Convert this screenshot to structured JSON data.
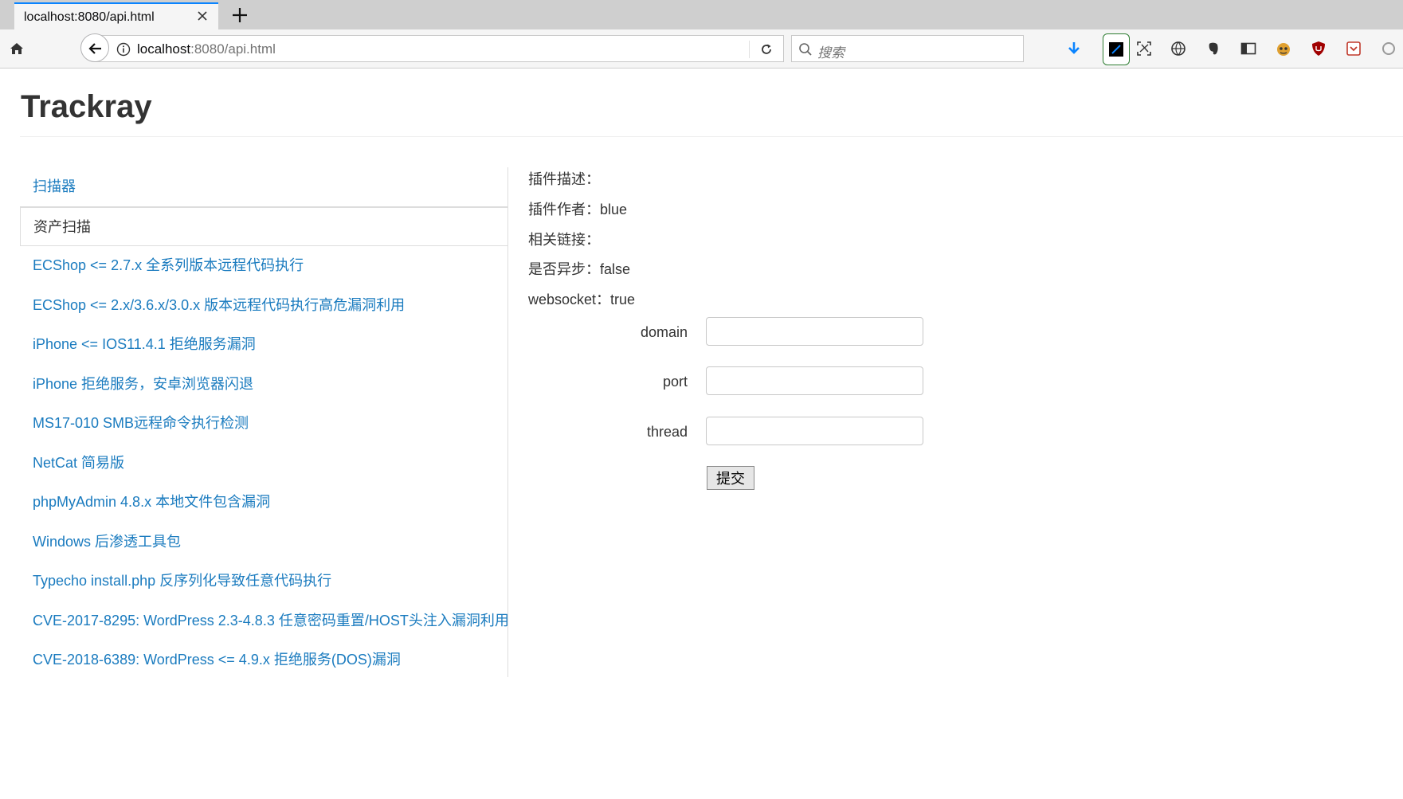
{
  "browser": {
    "tab_title": "localhost:8080/api.html",
    "url_host": "localhost",
    "url_rest": ":8080/api.html",
    "search_placeholder": "搜索",
    "accent_color": "#0a84ff"
  },
  "page": {
    "title": "Trackray"
  },
  "sidebar": {
    "items": [
      {
        "label": "扫描器",
        "type": "link"
      },
      {
        "label": "资产扫描",
        "type": "category"
      },
      {
        "label": "ECShop <= 2.7.x 全系列版本远程代码执行",
        "type": "link"
      },
      {
        "label": "ECShop <= 2.x/3.6.x/3.0.x 版本远程代码执行高危漏洞利用",
        "type": "link"
      },
      {
        "label": "iPhone <= IOS11.4.1 拒绝服务漏洞",
        "type": "link"
      },
      {
        "label": "iPhone 拒绝服务，安卓浏览器闪退",
        "type": "link"
      },
      {
        "label": "MS17-010 SMB远程命令执行检测",
        "type": "link"
      },
      {
        "label": "NetCat 简易版",
        "type": "link"
      },
      {
        "label": "phpMyAdmin 4.8.x 本地文件包含漏洞",
        "type": "link"
      },
      {
        "label": "Windows 后渗透工具包",
        "type": "link"
      },
      {
        "label": "Typecho install.php 反序列化导致任意代码执行",
        "type": "link"
      },
      {
        "label": "CVE-2017-8295: WordPress 2.3-4.8.3 任意密码重置/HOST头注入漏洞利用",
        "type": "link"
      },
      {
        "label": "CVE-2018-6389: WordPress <= 4.9.x 拒绝服务(DOS)漏洞",
        "type": "link"
      }
    ],
    "link_color": "#1a7bbf"
  },
  "detail": {
    "description": "插件描述：",
    "author": "插件作者：blue",
    "links": "相关链接：",
    "async": "是否异步：false",
    "websocket": "websocket：true"
  },
  "form": {
    "fields": [
      {
        "label": "domain",
        "value": ""
      },
      {
        "label": "port",
        "value": ""
      },
      {
        "label": "thread",
        "value": ""
      }
    ],
    "submit_label": "提交"
  }
}
